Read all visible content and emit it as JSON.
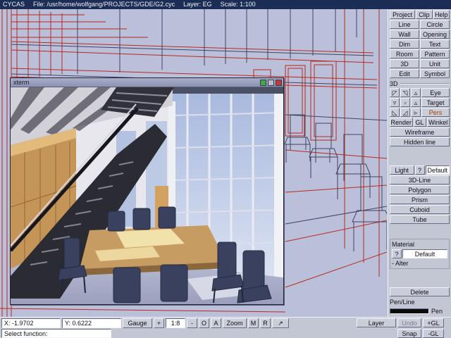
{
  "colors": {
    "titlebar_bg": "#1c2d55",
    "panel_bg": "#c3c7d4",
    "canvas_bg": "#bac0da",
    "wireframe_red": "#b92a1e",
    "wireframe_dark": "#3f4560",
    "window_button_green": "#3fa945",
    "window_button_gray": "#b9bdc9",
    "window_button_red": "#c23b32"
  },
  "title_bar": {
    "app_name": "CYCAS",
    "file": "File: /usr/home/wolfgang/PROJECTS/GDE/G2.cyc",
    "layer": "Layer: EG",
    "scale": "Scale: 1:100"
  },
  "xterm": {
    "title": "xterm"
  },
  "right_panel": {
    "menu": [
      "Project",
      "Clip",
      "Help"
    ],
    "tools": [
      {
        "left": "Line",
        "right": "Circle"
      },
      {
        "left": "Wall",
        "right": "Opening"
      },
      {
        "left": "Dim",
        "right": "Text"
      },
      {
        "left": "Room",
        "right": "Pattern"
      },
      {
        "left": "3D",
        "right": "Unit"
      },
      {
        "left": "Edit",
        "right": "Symbol"
      }
    ],
    "section3d": {
      "label": "3D",
      "rows": [
        {
          "b1": "◸",
          "b2": "◹",
          "b3": "▵",
          "side": "Eye"
        },
        {
          "b1": "▿",
          "b2": "▫",
          "b3": "▵",
          "side": "Target"
        },
        {
          "b1": "◺",
          "b2": "◿",
          "b3": "▹",
          "side": "Pers"
        }
      ],
      "render": "Render",
      "gl": "GL",
      "winkel": "Winkel",
      "wireframe": "Wireframe",
      "hidden_line": "Hidden line"
    },
    "light": {
      "label": "Light",
      "help": "?",
      "value": "Default"
    },
    "solids": [
      "3D-Line",
      "Polygon",
      "Prism",
      "Cuboid",
      "Tube"
    ],
    "material": {
      "label": "Material",
      "help": "?",
      "value": "Default",
      "alter": "- Alter"
    },
    "delete_label": "Delete",
    "penline": {
      "label": "Pen/Line",
      "pen": "Pen",
      "line": "Line"
    }
  },
  "bottom_bar": {
    "x": "X: -1.9702",
    "y": "Y: 0.6222",
    "gauge": "Gauge",
    "plus": "+",
    "ratio": "1:8",
    "minus": "-",
    "o": "O",
    "a": "A",
    "zoom": "Zoom",
    "m": "M",
    "r": "R",
    "pointer_icon": "↗",
    "layer": "Layer",
    "undo": "Undo",
    "plus_gl": "+GL",
    "snap": "Snap",
    "minus_gl": "-GL",
    "status": "Select function:"
  }
}
